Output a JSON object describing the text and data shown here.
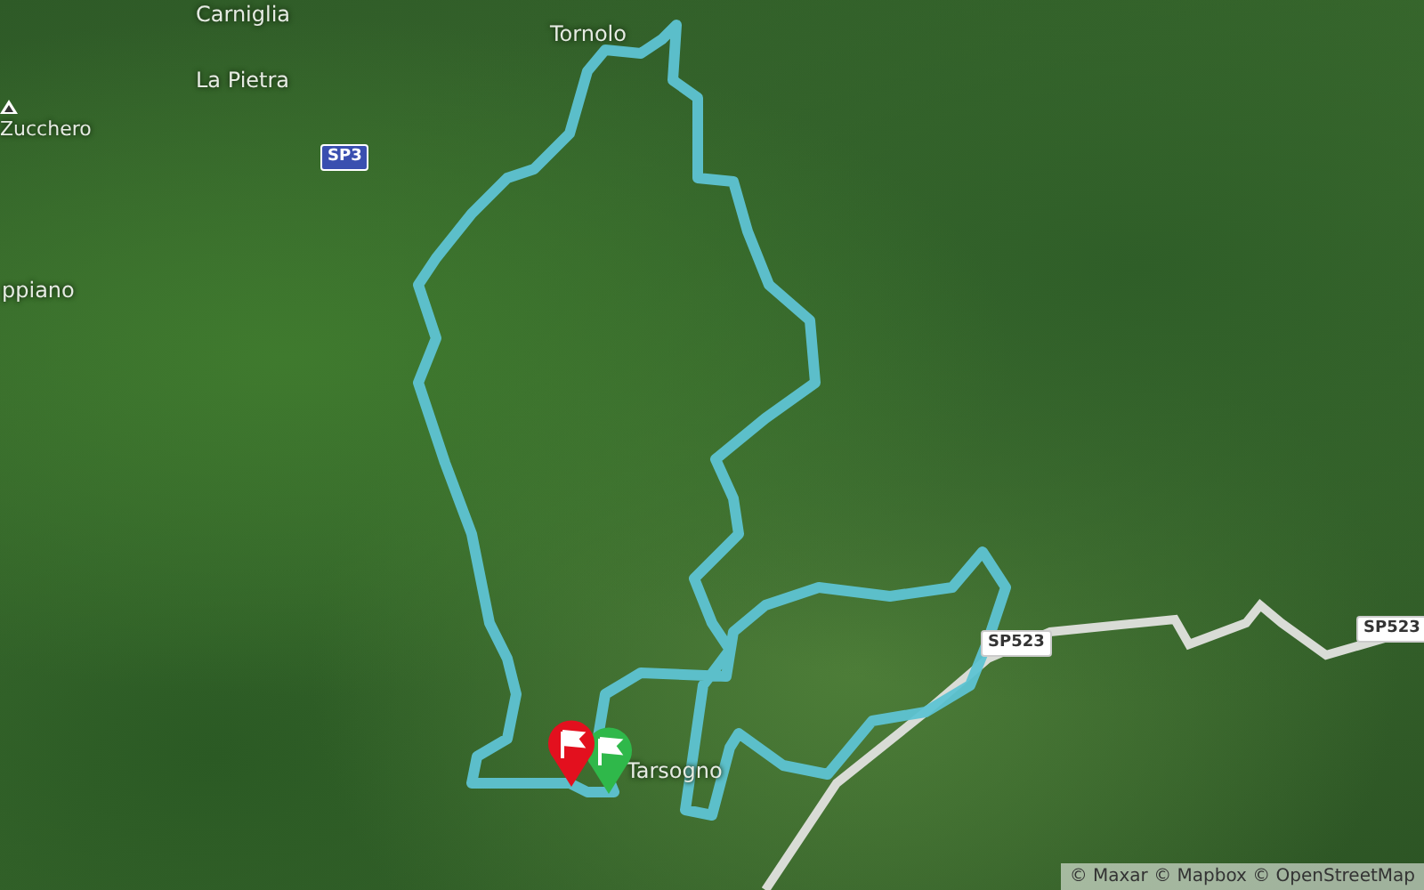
{
  "map": {
    "places": [
      {
        "name": "Carniglia",
        "kind": "town"
      },
      {
        "name": "La Pietra",
        "kind": "town"
      },
      {
        "name": "Zucchero",
        "kind": "peak"
      },
      {
        "name": "ppiano",
        "kind": "town"
      },
      {
        "name": "Tornolo",
        "kind": "town"
      },
      {
        "name": "Tarsogno",
        "kind": "town"
      }
    ],
    "road_badges": [
      {
        "label": "SP3",
        "kind": "provincial"
      },
      {
        "label": "SP523",
        "kind": "regional"
      },
      {
        "label": "SP523",
        "kind": "regional"
      }
    ],
    "markers": [
      {
        "kind": "flag",
        "color": "#2fb84a"
      },
      {
        "kind": "flag",
        "color": "#e3101e"
      }
    ],
    "attribution": "© Maxar © Mapbox © OpenStreetMap"
  }
}
